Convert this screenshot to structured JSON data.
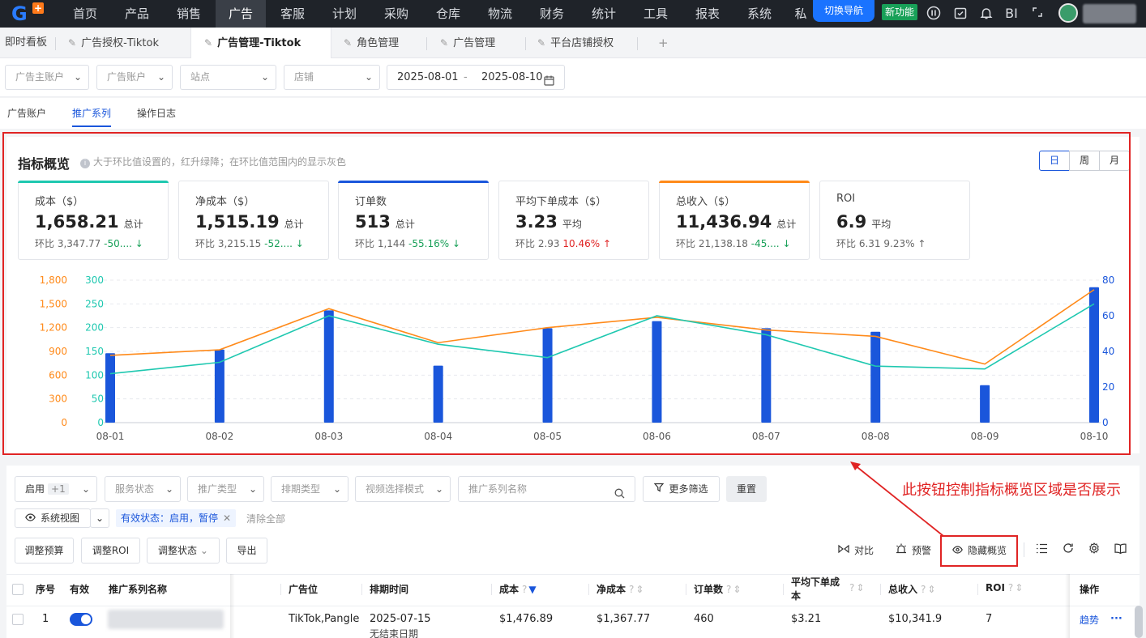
{
  "topnav": {
    "items": [
      "首页",
      "产品",
      "销售",
      "广告",
      "客服",
      "计划",
      "采购",
      "仓库",
      "物流",
      "财务",
      "统计",
      "工具",
      "报表",
      "系统",
      "私"
    ],
    "active_index": 3,
    "switch_nav": "切换导航",
    "new_feature": "新功能",
    "bi": "BI"
  },
  "tabs": {
    "items": [
      "即时看板",
      "广告授权-Tiktok",
      "广告管理-Tiktok",
      "角色管理",
      "广告管理",
      "平台店铺授权"
    ],
    "active_index": 2,
    "add": "+"
  },
  "filters": {
    "advertiser": "广告主账户",
    "ad_account": "广告账户",
    "site": "站点",
    "store": "店铺",
    "date_start": "2025-08-01",
    "date_sep": "-",
    "date_end": "2025-08-10"
  },
  "subtabs": {
    "items": [
      "广告账户",
      "推广系列",
      "操作日志"
    ],
    "active_index": 1
  },
  "overview": {
    "title": "指标概览",
    "tip": "大于环比值设置的，红升绿降；在环比值范围内的显示灰色",
    "periods": [
      "日",
      "周",
      "月"
    ],
    "active_period": 0,
    "kpis": [
      {
        "name": "成本（$）",
        "value": "1,658.21",
        "unit": "总计",
        "cmp_label": "环比",
        "cmp_value": "3,347.77",
        "pct": "-50....",
        "trend": "down",
        "color": "#1fc8b0"
      },
      {
        "name": "净成本（$）",
        "value": "1,515.19",
        "unit": "总计",
        "cmp_label": "环比",
        "cmp_value": "3,215.15",
        "pct": "-52....",
        "trend": "down",
        "color": ""
      },
      {
        "name": "订单数",
        "value": "513",
        "unit": "总计",
        "cmp_label": "环比",
        "cmp_value": "1,144",
        "pct": "-55.16%",
        "trend": "down",
        "color": "#1a56db"
      },
      {
        "name": "平均下单成本（$）",
        "value": "3.23",
        "unit": "平均",
        "cmp_label": "环比",
        "cmp_value": "2.93",
        "pct": "10.46%",
        "trend": "up",
        "color": ""
      },
      {
        "name": "总收入（$）",
        "value": "11,436.94",
        "unit": "总计",
        "cmp_label": "环比",
        "cmp_value": "21,138.18",
        "pct": "-45....",
        "trend": "down",
        "color": "#ff8a1a"
      },
      {
        "name": "ROI",
        "value": "6.9",
        "unit": "平均",
        "cmp_label": "环比",
        "cmp_value": "6.31",
        "pct": "9.23%",
        "trend": "neutral",
        "color": ""
      }
    ]
  },
  "chart_data": {
    "type": "bar",
    "categories": [
      "08-01",
      "08-02",
      "08-03",
      "08-04",
      "08-05",
      "08-06",
      "08-07",
      "08-08",
      "08-09",
      "08-10"
    ],
    "series": [
      {
        "type": "bar",
        "axis": "right",
        "color": "#1a56db",
        "values": [
          39,
          41,
          63,
          32,
          53,
          57,
          53,
          51,
          21,
          76
        ]
      },
      {
        "type": "line",
        "axis": "left-orange",
        "color": "#ff8a1a",
        "values": [
          850,
          920,
          1440,
          1010,
          1200,
          1330,
          1170,
          1090,
          740,
          1680
        ]
      },
      {
        "type": "line",
        "axis": "left-teal",
        "color": "#1fc8b0",
        "values": [
          103,
          127,
          225,
          165,
          137,
          225,
          185,
          119,
          113,
          250
        ]
      }
    ],
    "y_left_orange": {
      "ticks": [
        "0",
        "300",
        "600",
        "900",
        "1,200",
        "1,500",
        "1,800"
      ],
      "range": [
        0,
        1800
      ],
      "color": "#ff8a1a"
    },
    "y_left_teal": {
      "ticks": [
        "0",
        "50",
        "100",
        "150",
        "200",
        "250",
        "300"
      ],
      "range": [
        0,
        300
      ],
      "color": "#1fc8b0"
    },
    "y_right": {
      "ticks": [
        "0",
        "20",
        "40",
        "60",
        "80"
      ],
      "range": [
        0,
        80
      ],
      "color": "#1a56db"
    },
    "grid": true,
    "legend": "none"
  },
  "annotation": "此按钮控制指标概览区域是否展示",
  "table_filters": {
    "enable": "启用",
    "enable_more": "+1",
    "service_status": "服务状态",
    "promo_type": "推广类型",
    "schedule_type": "排期类型",
    "video_mode": "视频选择模式",
    "search_placeholder": "推广系列名称",
    "more_filters": "更多筛选",
    "reset": "重置",
    "system_view": "系统视图",
    "chip": "有效状态：启用，暂停",
    "clear_all": "清除全部"
  },
  "toolbar": {
    "adjust_budget": "调整预算",
    "adjust_roi": "调整ROI",
    "adjust_status": "调整状态",
    "export": "导出",
    "compare": "对比",
    "alert": "预警",
    "hide_overview": "隐藏概览"
  },
  "table": {
    "headers": {
      "index": "序号",
      "valid": "有效",
      "name": "推广系列名称",
      "placement": "广告位",
      "schedule": "排期时间",
      "cost": "成本",
      "net_cost": "净成本",
      "orders": "订单数",
      "avg_cost_1": "平均下单成",
      "avg_cost_2": "本",
      "revenue": "总收入",
      "roi": "ROI",
      "action": "操作"
    },
    "rows": [
      {
        "index": "1",
        "placement": "TikTok,Pangle",
        "schedule": "2025-07-15",
        "schedule_end": "无结束日期",
        "cost": "$1,476.89",
        "net_cost": "$1,367.77",
        "orders": "460",
        "avg_cost": "$3.21",
        "revenue": "$10,341.9",
        "roi": "7",
        "action": "趋势",
        "more": "···"
      }
    ]
  }
}
